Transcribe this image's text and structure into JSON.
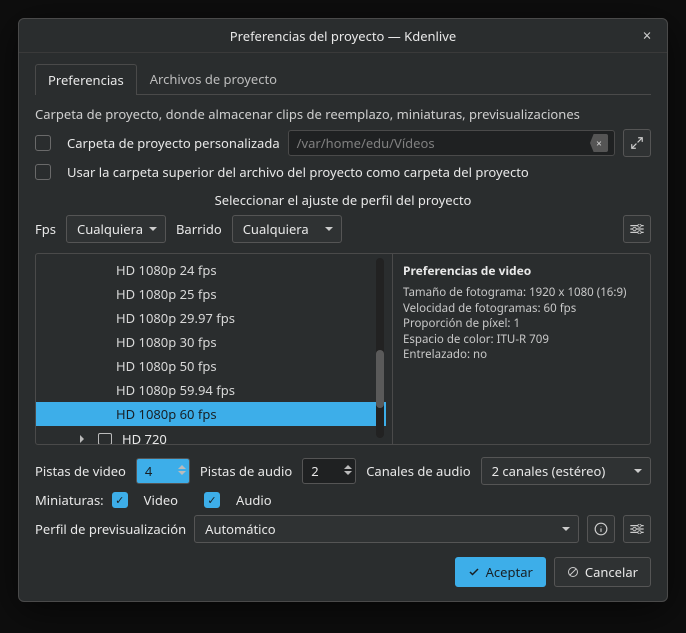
{
  "window": {
    "title": "Preferencias del proyecto — Kdenlive"
  },
  "tabs": {
    "preferences": "Preferencias",
    "project_files": "Archivos de proyecto"
  },
  "folder": {
    "description": "Carpeta de proyecto, donde almacenar clips de reemplazo, miniaturas, previsualizaciones",
    "custom_label": "Carpeta de proyecto personalizada",
    "path": "/var/home/edu/Vídeos",
    "use_parent_label": "Usar la carpeta superior del archivo del proyecto como carpeta del proyecto"
  },
  "profile": {
    "select_label": "Seleccionar el ajuste de perfil del proyecto",
    "fps_label": "Fps",
    "fps_value": "Cualquiera",
    "scan_label": "Barrido",
    "scan_value": "Cualquiera"
  },
  "tree": {
    "items": [
      "HD 1080p 24 fps",
      "HD 1080p 25 fps",
      "HD 1080p 29.97 fps",
      "HD 1080p 30 fps",
      "HD 1080p 50 fps",
      "HD 1080p 59.94 fps",
      "HD 1080p 60 fps"
    ],
    "selected_index": 6,
    "group": "HD 720"
  },
  "details": {
    "heading": "Preferencias de video",
    "frame_size": "Tamaño de fotograma: 1920 x 1080 (16:9)",
    "frame_rate": "Velocidad de fotogramas: 60 fps",
    "pixel_ratio": "Proporción de píxel: 1",
    "colorspace": "Espacio de color: ITU-R 709",
    "interlaced": "Entrelazado: no"
  },
  "tracks": {
    "video_label": "Pistas de video",
    "video_value": "4",
    "audio_label": "Pistas de audio",
    "audio_value": "2",
    "channels_label": "Canales de audio",
    "channels_value": "2 canales (estéreo)"
  },
  "thumbs": {
    "label": "Miniaturas:",
    "video": "Video",
    "audio": "Audio"
  },
  "preview": {
    "label": "Perfil de previsualización",
    "value": "Automático"
  },
  "buttons": {
    "accept": "Aceptar",
    "cancel": "Cancelar"
  }
}
